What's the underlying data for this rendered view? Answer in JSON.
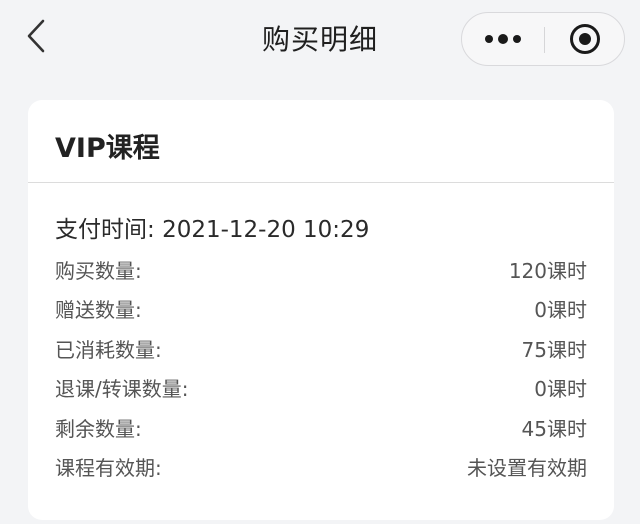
{
  "nav": {
    "title": "购买明细",
    "back_icon": "chevron-left-icon",
    "more_icon": "more-dots-icon",
    "close_icon": "target-circle-icon"
  },
  "card": {
    "title": "VIP课程",
    "pay_time_label": "支付时间:",
    "pay_time_value": "2021-12-20 10:29",
    "rows": [
      {
        "label": "购买数量:",
        "value": "120课时"
      },
      {
        "label": "赠送数量:",
        "value": "0课时"
      },
      {
        "label": "已消耗数量:",
        "value": "75课时"
      },
      {
        "label": "退课/转课数量:",
        "value": "0课时"
      },
      {
        "label": "剩余数量:",
        "value": "45课时"
      },
      {
        "label": "课程有效期:",
        "value": "未设置有效期"
      }
    ]
  }
}
